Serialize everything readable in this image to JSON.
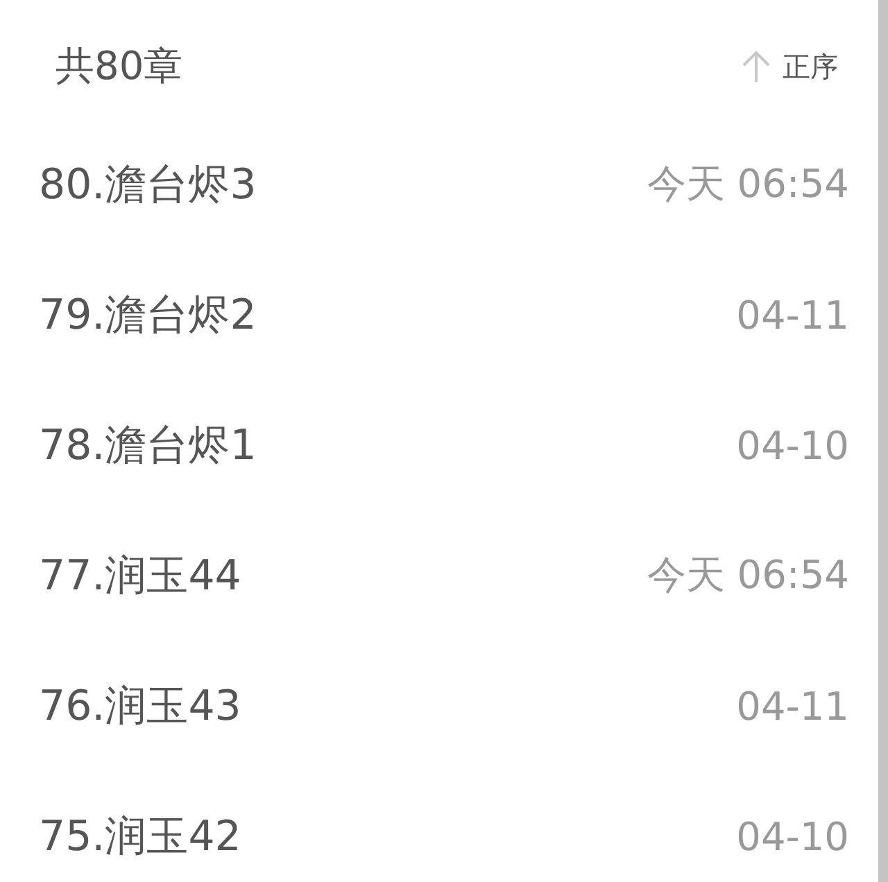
{
  "header": {
    "count": "共80章",
    "sort_label": "正序"
  },
  "chapters": [
    {
      "title": "80.澹台烬3",
      "time": "今天 06:54"
    },
    {
      "title": "79.澹台烬2",
      "time": "04-11"
    },
    {
      "title": "78.澹台烬1",
      "time": "04-10"
    },
    {
      "title": "77.润玉44",
      "time": "今天 06:54"
    },
    {
      "title": "76.润玉43",
      "time": "04-11"
    },
    {
      "title": "75.润玉42",
      "time": "04-10"
    }
  ]
}
